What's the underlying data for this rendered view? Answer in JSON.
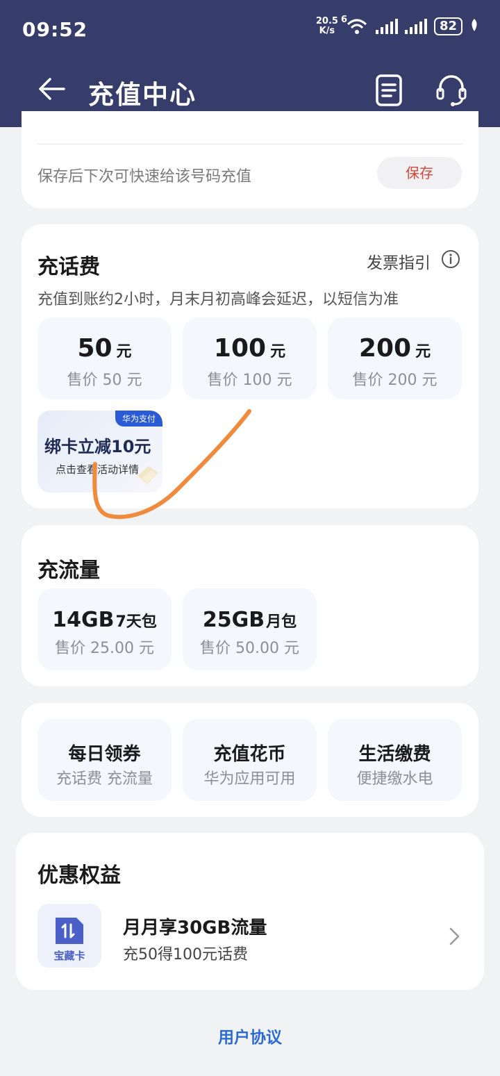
{
  "status_bar": {
    "time": "09:52",
    "net_speed_value": "20.5",
    "net_speed_unit": "K/s",
    "wifi_gen": "6",
    "battery": "82"
  },
  "header": {
    "title": "充值中心",
    "icons": [
      "back-arrow-icon",
      "document-icon",
      "customer-service-icon"
    ]
  },
  "save_card": {
    "hint": "保存后下次可快速给该号码充值",
    "save_label": "保存"
  },
  "phone_recharge": {
    "title": "充话费",
    "invoice_label": "发票指引",
    "note": "充值到账约2小时，月末月初高峰会延迟，以短信为准",
    "options": [
      {
        "amount": "50",
        "unit": "元",
        "price": "售价 50 元"
      },
      {
        "amount": "100",
        "unit": "元",
        "price": "售价 100 元"
      },
      {
        "amount": "200",
        "unit": "元",
        "price": "售价 200 元"
      }
    ],
    "promo": {
      "badge": "华为支付",
      "title": "绑卡立减10元",
      "subtitle": "点击查看活动详情"
    }
  },
  "data_recharge": {
    "title": "充流量",
    "options": [
      {
        "size": "14GB",
        "period": "7天包",
        "price": "售价 25.00 元"
      },
      {
        "size": "25GB",
        "period": "月包",
        "price": "售价 50.00 元"
      }
    ]
  },
  "services": [
    {
      "title": "每日领券",
      "subtitle": "充话费 充流量"
    },
    {
      "title": "充值花币",
      "subtitle": "华为应用可用"
    },
    {
      "title": "生活缴费",
      "subtitle": "便捷缴水电"
    }
  ],
  "benefits": {
    "title": "优惠权益",
    "item": {
      "icon_label": "宝藏卡",
      "title": "月月享30GB流量",
      "subtitle": "充50得100元话费"
    }
  },
  "footer": {
    "agreement": "用户协议"
  },
  "colors": {
    "header_bg": "#363d6b",
    "save_text": "#d4463c",
    "link": "#2a6ad6",
    "annotation_stroke": "#f08a3c"
  }
}
